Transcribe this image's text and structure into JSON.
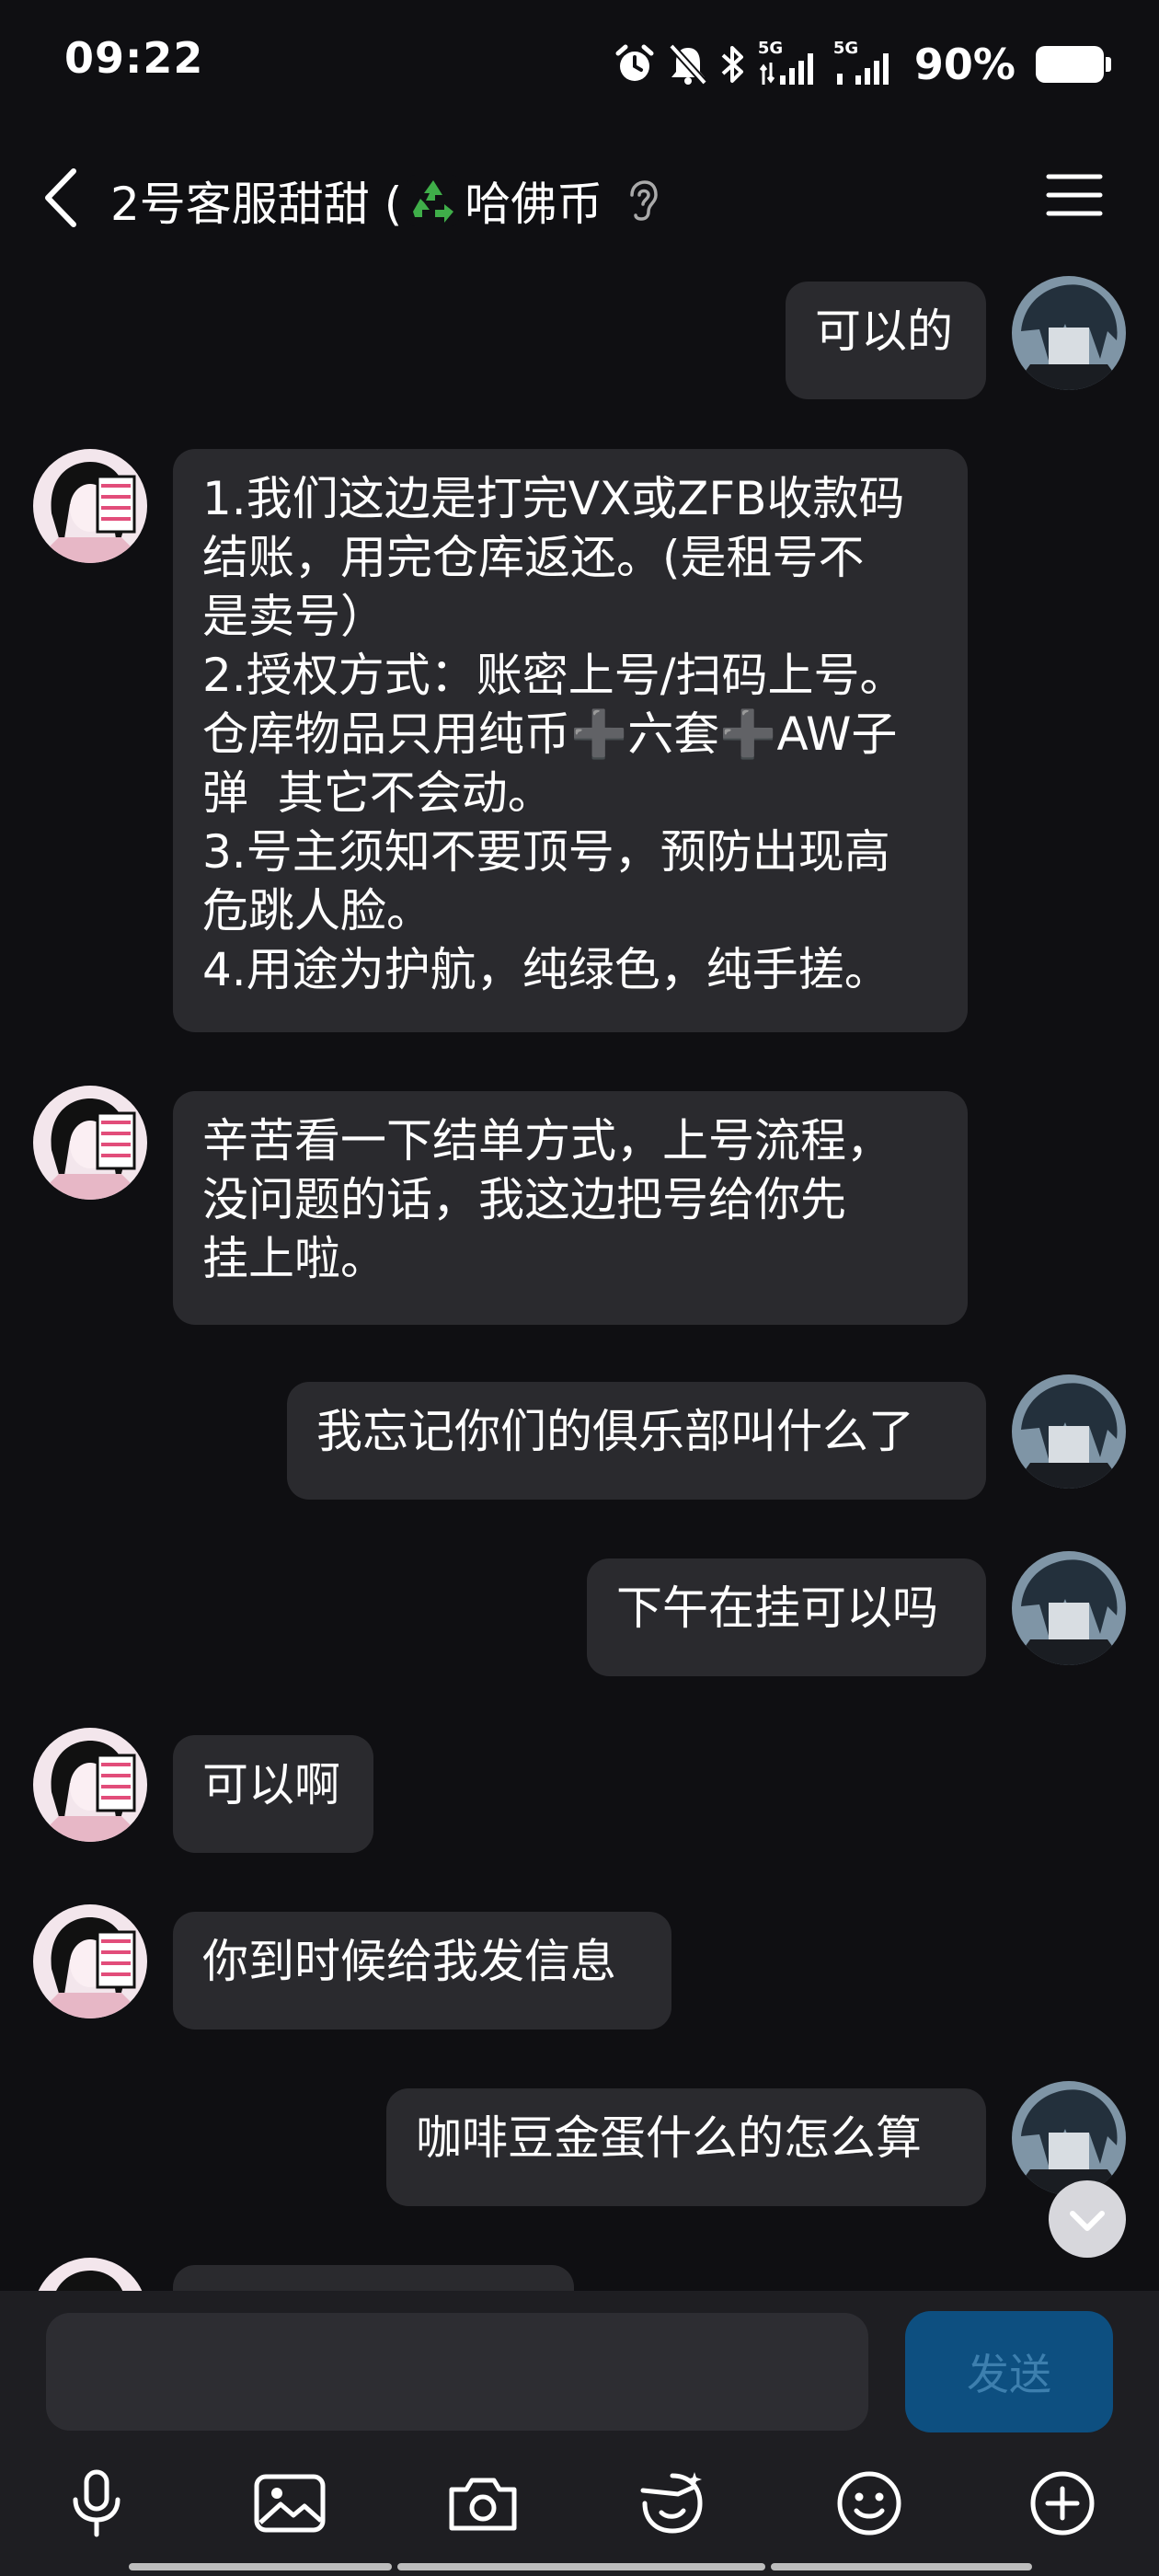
{
  "status_bar": {
    "time": "09:22",
    "network_1": "5G",
    "network_2": "5G",
    "battery": "90%",
    "icons": [
      "alarm-icon",
      "mute-icon",
      "bluetooth-icon",
      "signal-icon",
      "signal-icon",
      "battery-icon"
    ]
  },
  "header": {
    "title_prefix": "2号客服甜甜 (",
    "title_emoji": "recycle-icon",
    "title_suffix": "哈佛币",
    "icons": [
      "back-icon",
      "ear-icon",
      "menu-icon"
    ]
  },
  "messages": [
    {
      "sender": "me",
      "text": "可以的"
    },
    {
      "sender": "them",
      "text": "1.我们这边是打完VX或ZFB收款码\n结账，用完仓库返还。(是租号不\n是卖号）\n2.授权方式：账密上号/扫码上号。\n仓库物品只用纯币➕六套➕AW子\n弹  其它不会动。\n3.号主须知不要顶号，预防出现高\n危跳人脸。\n4.用途为护航，纯绿色，纯手搓。"
    },
    {
      "sender": "them",
      "text": "辛苦看一下结单方式，上号流程，\n没问题的话，我这边把号给你先\n挂上啦。"
    },
    {
      "sender": "me",
      "text": "我忘记你们的俱乐部叫什么了"
    },
    {
      "sender": "me",
      "text": "下午在挂可以吗"
    },
    {
      "sender": "them",
      "text": "可以啊"
    },
    {
      "sender": "them",
      "text": "你到时候给我发信息"
    },
    {
      "sender": "me",
      "text": "咖啡豆金蛋什么的怎么算"
    },
    {
      "sender": "them",
      "text": ""
    }
  ],
  "composer": {
    "input_value": "",
    "send_label": "发送",
    "tools": [
      "microphone-icon",
      "image-icon",
      "camera-icon",
      "sticker-icon",
      "emoji-icon",
      "plus-icon"
    ]
  },
  "colors": {
    "background": "#0f0f12",
    "bubble": "#2a2a2e",
    "send_button": "#0d4f80",
    "send_text": "#3d7fae"
  }
}
